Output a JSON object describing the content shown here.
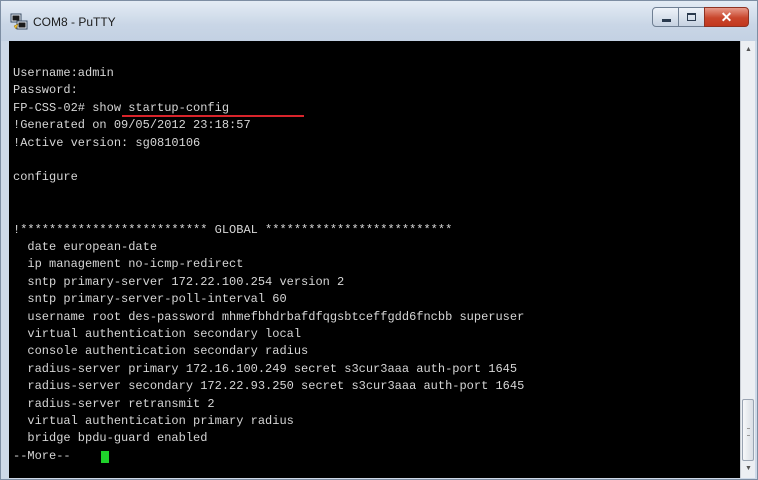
{
  "window": {
    "title": "COM8 - PuTTY",
    "controls": {
      "close_glyph": "✕"
    }
  },
  "terminal": {
    "lines": [
      "Username:admin",
      "Password:",
      "FP-CSS-02# show startup-config",
      "!Generated on 09/05/2012 23:18:57",
      "!Active version: sg0810106",
      "",
      "configure",
      "",
      "",
      "!************************** GLOBAL **************************",
      "  date european-date",
      "  ip management no-icmp-redirect",
      "  sntp primary-server 172.22.100.254 version 2",
      "  sntp primary-server-poll-interval 60",
      "  username root des-password mhmefbhdrbafdfqgsbtceffgdd6fncbb superuser",
      "  virtual authentication secondary local",
      "  console authentication secondary radius",
      "  radius-server primary 172.16.100.249 secret s3cur3aaa auth-port 1645",
      "  radius-server secondary 172.22.93.250 secret s3cur3aaa auth-port 1645",
      "  radius-server retransmit 2",
      "  virtual authentication primary radius",
      "  bridge bpdu-guard enabled",
      "--More--"
    ],
    "highlighted_command": "show startup-config"
  },
  "colors": {
    "text": "#d6d6d6",
    "background": "#000000",
    "cursor": "#1fd12b",
    "underline": "#d9242b"
  }
}
